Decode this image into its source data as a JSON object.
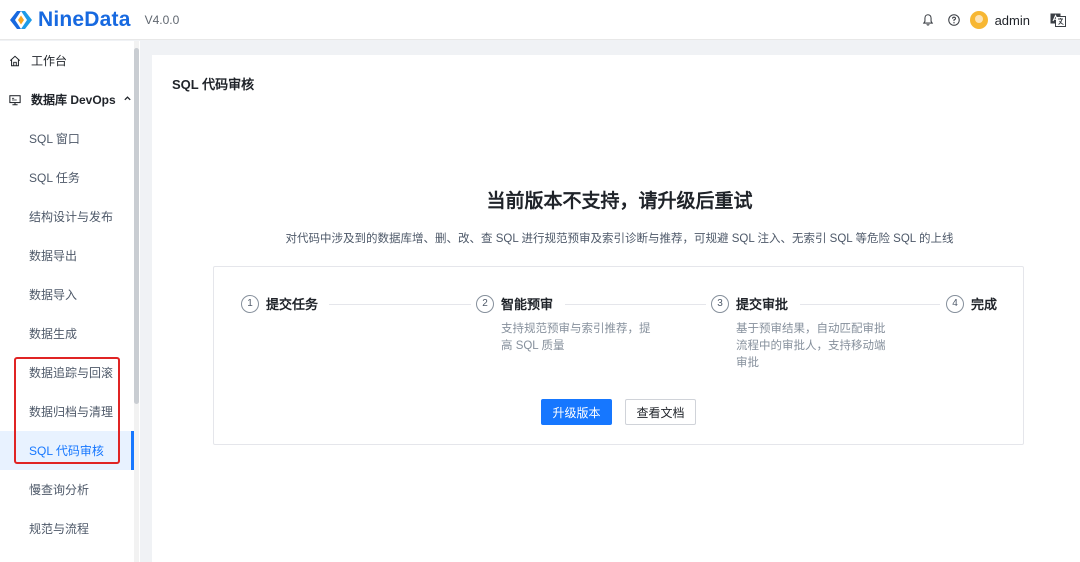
{
  "header": {
    "brand": "NineData",
    "version": "V4.0.0",
    "username": "admin",
    "icons": [
      "logo-icon",
      "bell-icon",
      "help-icon",
      "avatar",
      "translate-icon"
    ]
  },
  "sidebar": {
    "items": [
      {
        "label": "工作台",
        "icon": "home-icon"
      },
      {
        "label": "数据库 DevOps",
        "icon": "monitor-icon",
        "expanded": true
      },
      {
        "label": "SQL 窗口"
      },
      {
        "label": "SQL 任务"
      },
      {
        "label": "结构设计与发布"
      },
      {
        "label": "数据导出"
      },
      {
        "label": "数据导入"
      },
      {
        "label": "数据生成"
      },
      {
        "label": "数据追踪与回滚"
      },
      {
        "label": "数据归档与清理"
      },
      {
        "label": "SQL 代码审核",
        "active": true
      },
      {
        "label": "慢查询分析"
      },
      {
        "label": "规范与流程"
      }
    ],
    "active_color": "#1677ff",
    "highlight_box_color": "#e02424"
  },
  "main": {
    "title": "SQL 代码审核",
    "headline": "当前版本不支持，请升级后重试",
    "description": "对代码中涉及到的数据库增、删、改、查 SQL 进行规范预审及索引诊断与推荐，可规避 SQL 注入、无索引 SQL 等危险 SQL 的上线",
    "steps": [
      {
        "num": "1",
        "title": "提交任务",
        "desc": ""
      },
      {
        "num": "2",
        "title": "智能预审",
        "desc": "支持规范预审与索引推荐，提高 SQL 质量"
      },
      {
        "num": "3",
        "title": "提交审批",
        "desc": "基于预审结果，自动匹配审批流程中的审批人，支持移动端审批"
      },
      {
        "num": "4",
        "title": "完成",
        "desc": ""
      }
    ],
    "upgrade_button": "升级版本",
    "docs_button": "查看文档",
    "primary_color": "#1677ff"
  }
}
